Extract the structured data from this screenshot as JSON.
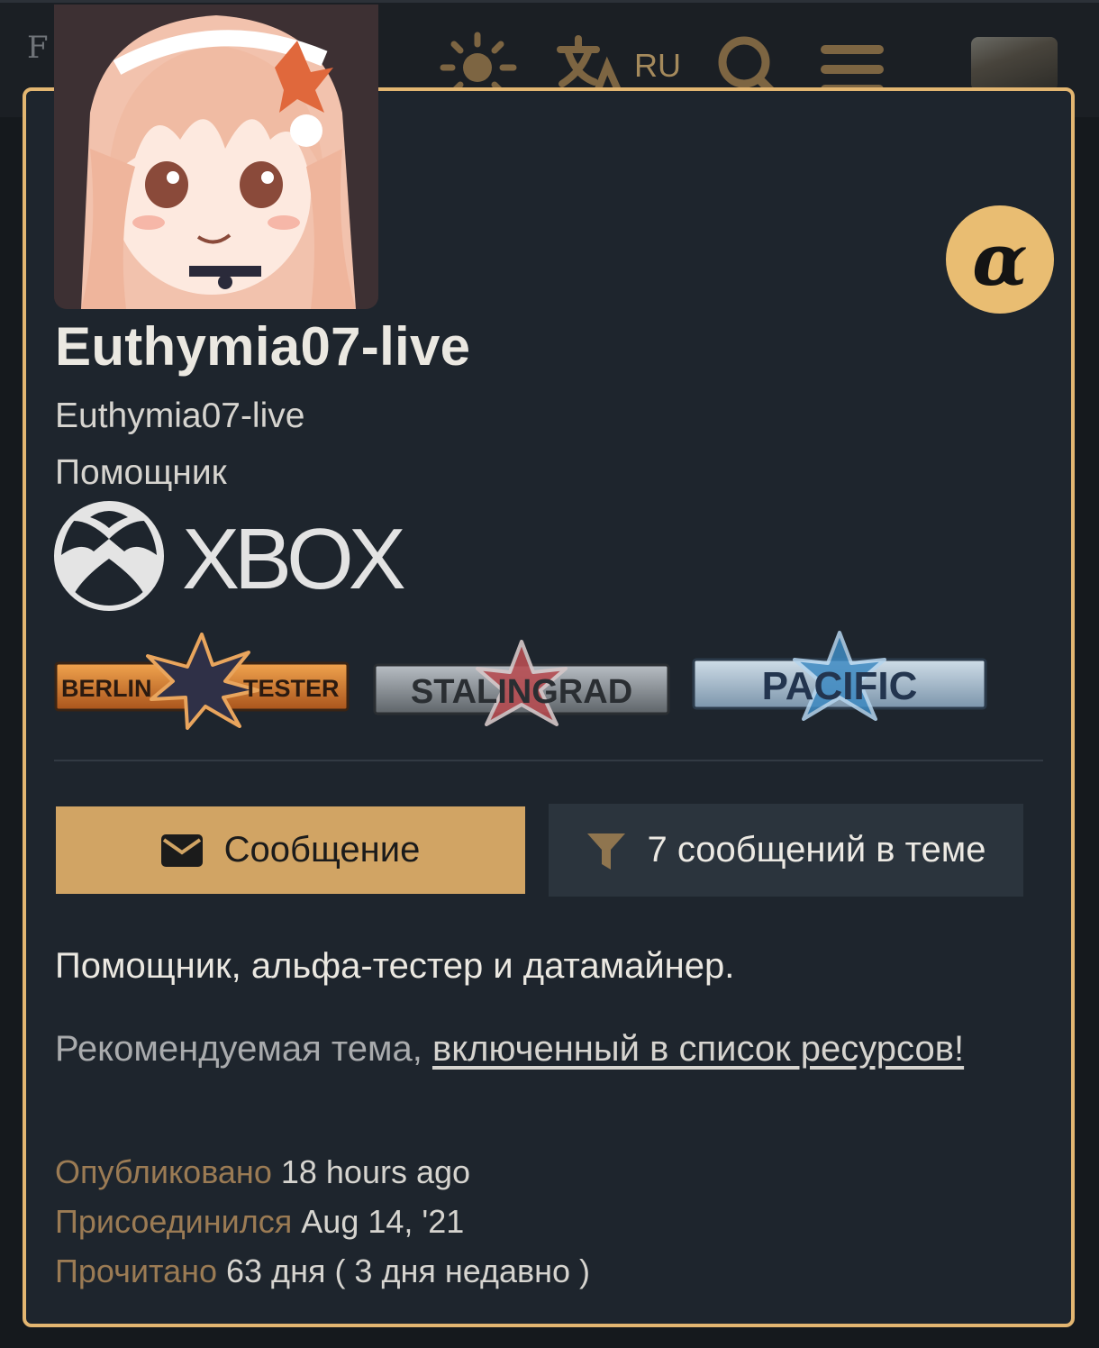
{
  "header": {
    "logo_text": "F",
    "language": "RU",
    "icons": [
      "theme-toggle-icon",
      "translate-icon",
      "search-icon",
      "menu-icon"
    ]
  },
  "card": {
    "display_name": "Euthymia07-live",
    "username": "Euthymia07-live",
    "user_title": "Помощник",
    "alpha_badge": "α",
    "platform_logo": "XBOX",
    "flairs": [
      {
        "left": "BERLIN",
        "right": "TESTER"
      },
      {
        "label": "STALINGRAD"
      },
      {
        "label": "PACIFIC"
      }
    ],
    "buttons": {
      "message": "Сообщение",
      "filter": "7 сообщений в теме"
    },
    "bio": "Помощник, альфа-тестер и датамайнер.",
    "featured_prefix": "Рекомендуемая тема, ",
    "featured_link": "включенный в список ресурсов!",
    "meta": [
      {
        "label": "Опубликовано",
        "value": "18 hours ago"
      },
      {
        "label": "Присоединился",
        "value": "Aug 14, '21"
      },
      {
        "label": "Прочитано",
        "value": "63 дня ( 3 дня недавно )"
      }
    ]
  },
  "colors": {
    "accent": "#e3b671",
    "button_primary": "#d1a464",
    "card_bg": "#1e252d",
    "meta_label": "#9b7b54"
  }
}
